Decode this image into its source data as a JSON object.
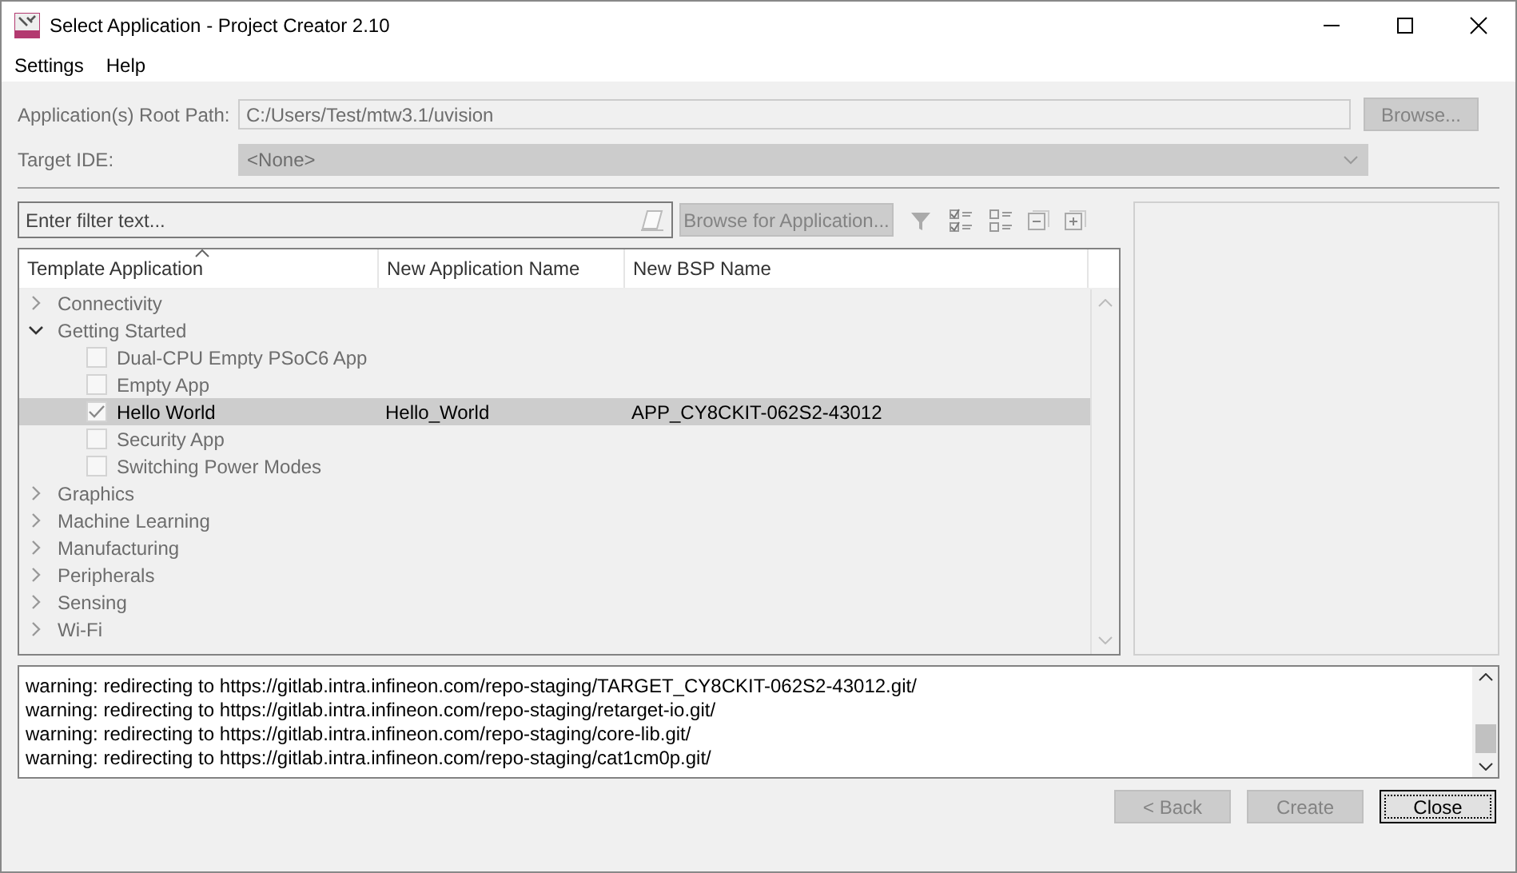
{
  "window": {
    "title": "Select Application - Project Creator 2.10"
  },
  "menu": [
    "Settings",
    "Help"
  ],
  "root_path": {
    "label": "Application(s) Root Path:",
    "value": "C:/Users/Test/mtw3.1/uvision",
    "button": "Browse...",
    "disabled": true
  },
  "target_ide": {
    "label": "Target IDE:",
    "value": "<None>",
    "disabled": true
  },
  "filter": {
    "placeholder": "Enter filter text...",
    "browse_button": "Browse for Application...",
    "disabled": true
  },
  "table": {
    "columns": [
      "Template Application",
      "New Application Name",
      "New BSP Name"
    ],
    "rows": [
      {
        "name": "Connectivity",
        "expanded": false,
        "children": []
      },
      {
        "name": "Getting Started",
        "expanded": true,
        "children": [
          {
            "name": "Dual-CPU Empty PSoC6 App",
            "checked": false,
            "selected": false
          },
          {
            "name": "Empty App",
            "checked": false,
            "selected": false
          },
          {
            "name": "Hello World",
            "checked": true,
            "selected": true,
            "app_name": "Hello_World",
            "bsp_name": "APP_CY8CKIT-062S2-43012"
          },
          {
            "name": "Security App",
            "checked": false,
            "selected": false
          },
          {
            "name": "Switching Power Modes",
            "checked": false,
            "selected": false
          }
        ]
      },
      {
        "name": "Graphics",
        "expanded": false,
        "children": []
      },
      {
        "name": "Machine Learning",
        "expanded": false,
        "children": []
      },
      {
        "name": "Manufacturing",
        "expanded": false,
        "children": []
      },
      {
        "name": "Peripherals",
        "expanded": false,
        "children": []
      },
      {
        "name": "Sensing",
        "expanded": false,
        "children": []
      },
      {
        "name": "Wi-Fi",
        "expanded": false,
        "children": []
      }
    ]
  },
  "log": [
    "warning: redirecting to https://gitlab.intra.infineon.com/repo-staging/TARGET_CY8CKIT-062S2-43012.git/",
    "warning: redirecting to https://gitlab.intra.infineon.com/repo-staging/retarget-io.git/",
    "warning: redirecting to https://gitlab.intra.infineon.com/repo-staging/core-lib.git/",
    "warning: redirecting to https://gitlab.intra.infineon.com/repo-staging/cat1cm0p.git/"
  ],
  "buttons": [
    {
      "label": "< Back",
      "disabled": true
    },
    {
      "label": "Create",
      "disabled": true
    },
    {
      "label": "Close",
      "disabled": false
    }
  ]
}
